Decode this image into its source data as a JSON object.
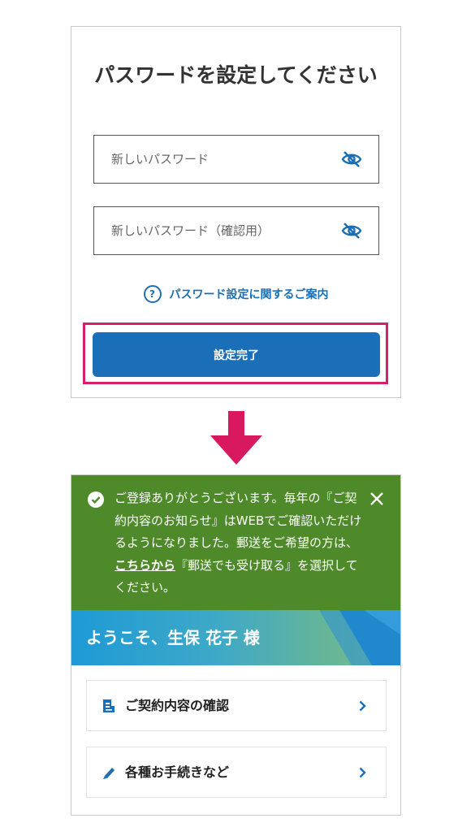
{
  "password_form": {
    "title": "パスワードを設定してください",
    "new_password_placeholder": "新しいパスワード",
    "confirm_password_placeholder": "新しいパスワード（確認用）",
    "help_link": "パスワード設定に関するご案内",
    "submit_button": "設定完了"
  },
  "registration_notice": {
    "message_before_link": "ご登録ありがとうございます。毎年の『ご契約内容のお知らせ』はWEBでご確認いただけるようになりました。郵送をご希望の方は、",
    "link_text": "こちらから",
    "message_after_link": "『郵送でも受け取る』を選択してください。"
  },
  "welcome_banner": {
    "text": "ようこそ、生保 花子 様"
  },
  "menu": [
    {
      "label": "ご契約内容の確認",
      "icon": "document-icon"
    },
    {
      "label": "各種お手続きなど",
      "icon": "pencil-icon"
    }
  ],
  "colors": {
    "primary_blue": "#1a6fb8",
    "highlight_pink": "#d4206c",
    "notice_green": "#4e8a2a",
    "arrow_pink": "#d8185f"
  }
}
